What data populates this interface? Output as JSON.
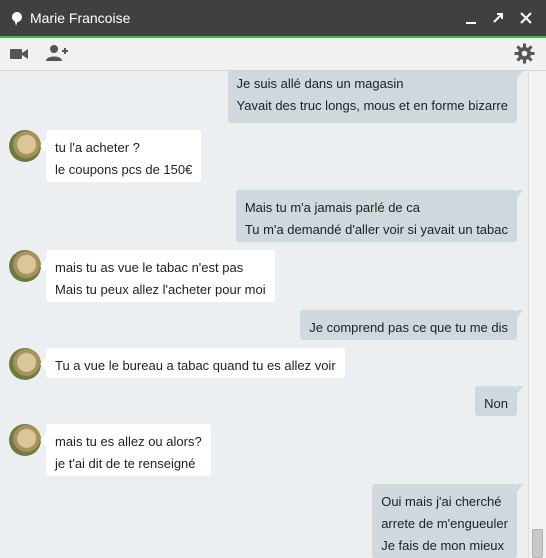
{
  "window": {
    "title": "Marie Francoise",
    "status_icon": "status-dot-icon",
    "controls": [
      "minimize-icon",
      "popout-icon",
      "close-icon"
    ]
  },
  "toolbar": {
    "left_icons": [
      "video-call-icon",
      "add-person-icon"
    ],
    "right_icon": "gear-icon"
  },
  "colors": {
    "titlebar": "#404040",
    "accent": "#3dbf3a",
    "outgoing_bubble": "#cfd8dc",
    "incoming_bubble": "#ffffff",
    "background": "#eceff1"
  },
  "messages": [
    {
      "side": "out",
      "lines": [
        "Je suis allé dans un magasin",
        "Yavait des truc longs, mous et en forme bizarre"
      ]
    },
    {
      "side": "in",
      "lines": [
        "tu l'a acheter ?",
        "le coupons pcs de 150€"
      ]
    },
    {
      "side": "out",
      "lines": [
        "Mais tu m'a jamais parlé de ca",
        "Tu m'a demandé d'aller voir si yavait un tabac"
      ]
    },
    {
      "side": "in",
      "lines": [
        "mais tu as vue le tabac n'est pas",
        "Mais tu peux allez l'acheter pour moi"
      ]
    },
    {
      "side": "out",
      "lines": [
        "Je comprend pas ce que tu me dis"
      ]
    },
    {
      "side": "in",
      "lines": [
        "Tu a vue le bureau a tabac quand tu es allez voir"
      ]
    },
    {
      "side": "out",
      "lines": [
        "Non"
      ]
    },
    {
      "side": "in",
      "lines": [
        "mais tu es allez ou alors?",
        "je t'ai dit de te renseigné"
      ]
    },
    {
      "side": "out",
      "lines": [
        "Oui mais j'ai cherché",
        "arrete de m'engueuler",
        "Je fais de mon mieux"
      ]
    }
  ]
}
